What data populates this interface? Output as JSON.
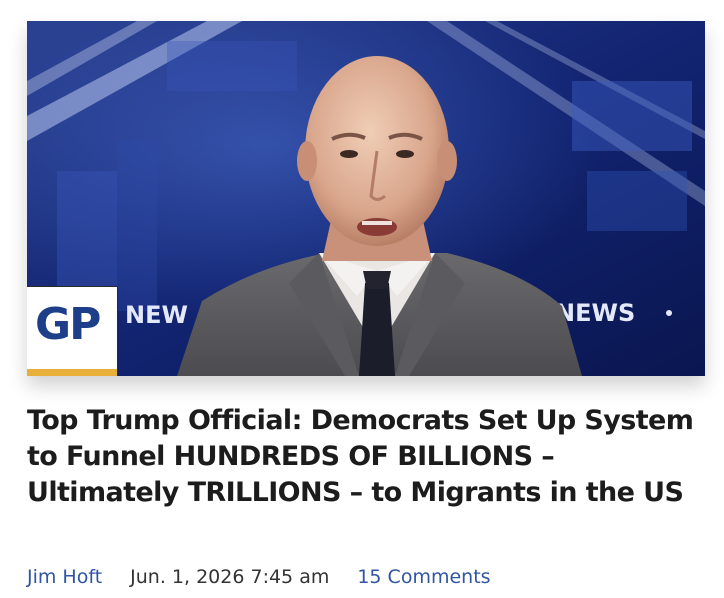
{
  "article": {
    "title": "Top Trump Official: Democrats Set Up System to Funnel HUNDREDS OF BILLIONS – Ultimately TRILLIONS – to Migrants in the US",
    "author": "Jim Hoft",
    "date": "Jun. 1, 2026 7:45 am",
    "comments": "15 Comments"
  },
  "image": {
    "logo_text": "GP",
    "backdrop_text_left": "NEW",
    "backdrop_text_right": "NEWS"
  },
  "colors": {
    "link": "#2f55a4",
    "logo_blue": "#1d3f8a",
    "logo_gold": "#e8b03a",
    "title": "#1c1c1c"
  }
}
